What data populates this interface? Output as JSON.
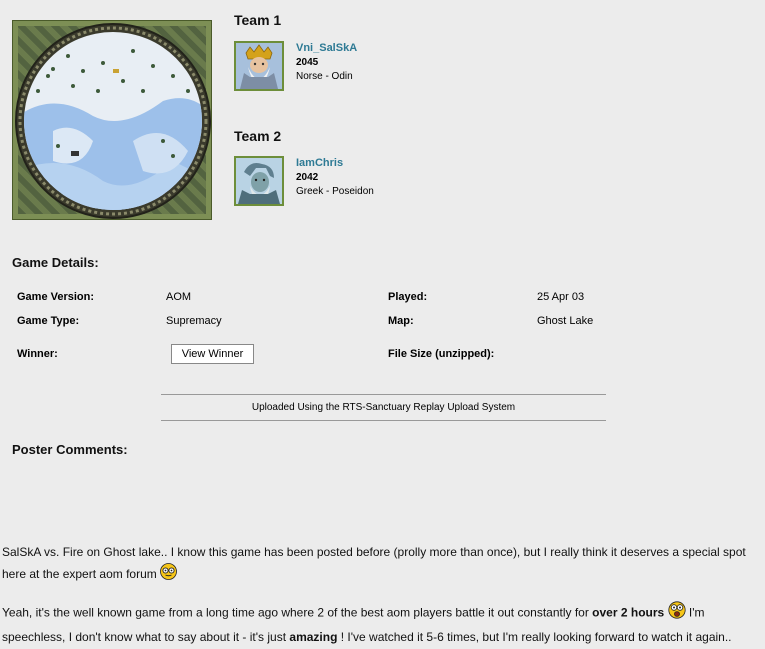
{
  "teams": [
    {
      "heading": "Team 1",
      "player": {
        "name": "Vni_SalSkA",
        "rating": "2045",
        "civ": "Norse - Odin"
      }
    },
    {
      "heading": "Team 2",
      "player": {
        "name": "IamChris",
        "rating": "2042",
        "civ": "Greek - Poseidon"
      }
    }
  ],
  "game_details": {
    "title": "Game Details:",
    "version_label": "Game Version:",
    "version_value": "AOM",
    "type_label": "Game Type:",
    "type_value": "Supremacy",
    "winner_label": "Winner:",
    "winner_button": "View Winner",
    "played_label": "Played:",
    "played_value": "25 Apr 03",
    "map_label": "Map:",
    "map_value": "Ghost Lake",
    "filesize_label": "File Size (unzipped):"
  },
  "upload_note": "Uploaded Using the RTS-Sanctuary Replay Upload System",
  "comments": {
    "title": "Poster Comments:",
    "p1_text": "SalSkA vs. Fire on Ghost lake.. I know this game has been posted before (prolly more than once), but I really think it deserves a special spot here at the expert aom forum",
    "p2_a": "Yeah, it's the well known game from a long time ago where 2 of the best aom players battle it out constantly for ",
    "p2_bold1": "over 2 hours",
    "p2_b": " I'm speechless, I don't know what to say about it - it's just ",
    "p2_bold2": "amazing",
    "p2_c": " ! I've watched it 5-6 times, but I'm really looking forward to watch it again.."
  },
  "icons": {
    "map": "ghost-lake-map-icon",
    "portrait1": "odin-portrait-icon",
    "portrait2": "poseidon-portrait-icon",
    "smiley1": "nerd-smiley-icon",
    "smiley2": "shocked-smiley-icon"
  },
  "colors": {
    "player_link": "#2e7a94",
    "portrait_border": "#6d8e3a",
    "background": "#ececec"
  }
}
